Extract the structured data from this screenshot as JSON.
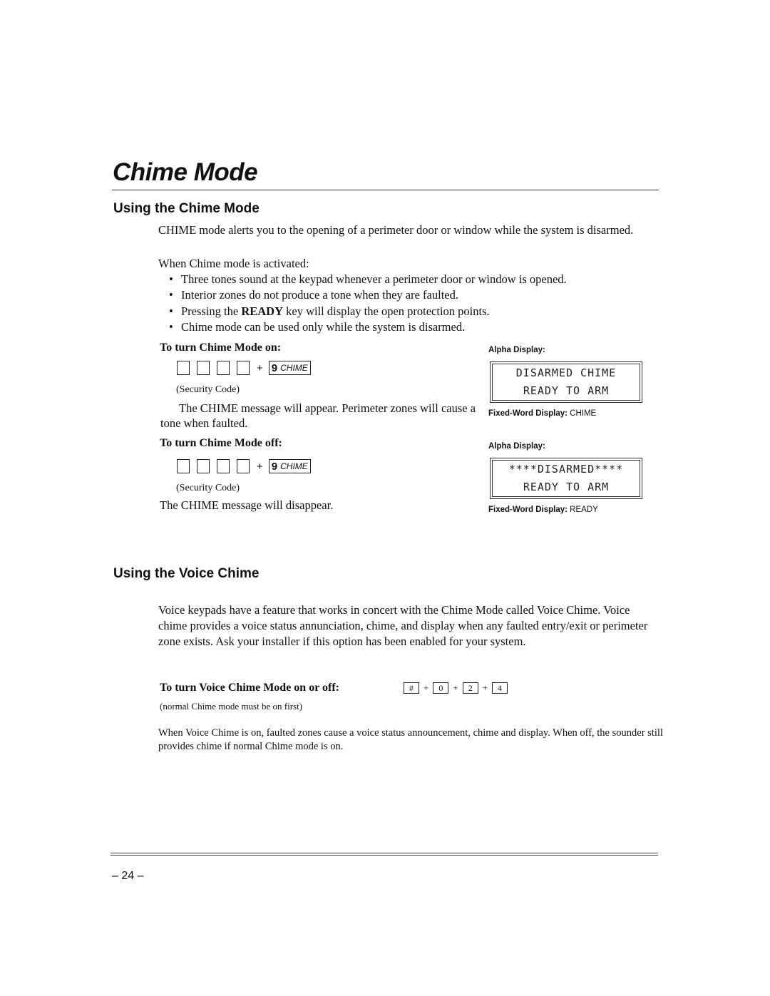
{
  "page": {
    "title": "Chime Mode",
    "page_number": "– 24 –"
  },
  "chime_section": {
    "heading": "Using the Chime Mode",
    "intro": "CHIME mode alerts you to the opening of a perimeter door or window while the system is disarmed.",
    "when_activated": "When Chime mode is activated:",
    "bullet_glyph": "•",
    "bullets": [
      "Three tones sound at the keypad whenever a perimeter door or window is opened.",
      "Interior zones do not produce a tone when they are faulted.",
      "Pressing the ",
      "Chime mode can be used only while the system is disarmed."
    ],
    "bullet3_bold": "READY",
    "bullet3_rest": " key will display the open protection points.",
    "turn_on": {
      "heading": "To turn Chime Mode on:",
      "plus": "+",
      "key_number": "9",
      "key_label": "CHIME",
      "security_code_label": "(Security Code)",
      "note": "The CHIME message will appear. Perimeter zones will cause a tone when faulted.",
      "alpha_display_caption": "Alpha Display:",
      "alpha_display_lines": [
        "DISARMED CHIME",
        "READY TO ARM"
      ],
      "fixed_word_caption": "Fixed-Word Display:",
      "fixed_word_value": "CHIME"
    },
    "turn_off": {
      "heading": "To turn Chime Mode off:",
      "plus": "+",
      "key_number": "9",
      "key_label": "CHIME",
      "security_code_label": "(Security Code)",
      "note": "The CHIME message will disappear.",
      "alpha_display_caption": "Alpha Display:",
      "alpha_display_lines": [
        "****DISARMED****",
        "READY TO ARM"
      ],
      "fixed_word_caption": "Fixed-Word Display:",
      "fixed_word_value": "READY"
    }
  },
  "voice_section": {
    "heading": "Using the Voice Chime",
    "paragraph": "Voice keypads have a feature that works in concert with the Chime Mode called Voice Chime. Voice chime provides a voice status annunciation, chime, and display when any faulted entry/exit or perimeter zone exists.  Ask your installer if this option has been enabled for your system.",
    "toggle_heading": "To turn Voice Chime Mode on or off:",
    "keys": [
      "#",
      "0",
      "2",
      "4"
    ],
    "plus": "+",
    "prerequisite_note": "(normal Chime mode must be on first)",
    "after_note": "When Voice Chime is on, faulted zones cause a voice status announcement, chime and display. When off, the sounder still provides chime if normal Chime mode is on."
  }
}
